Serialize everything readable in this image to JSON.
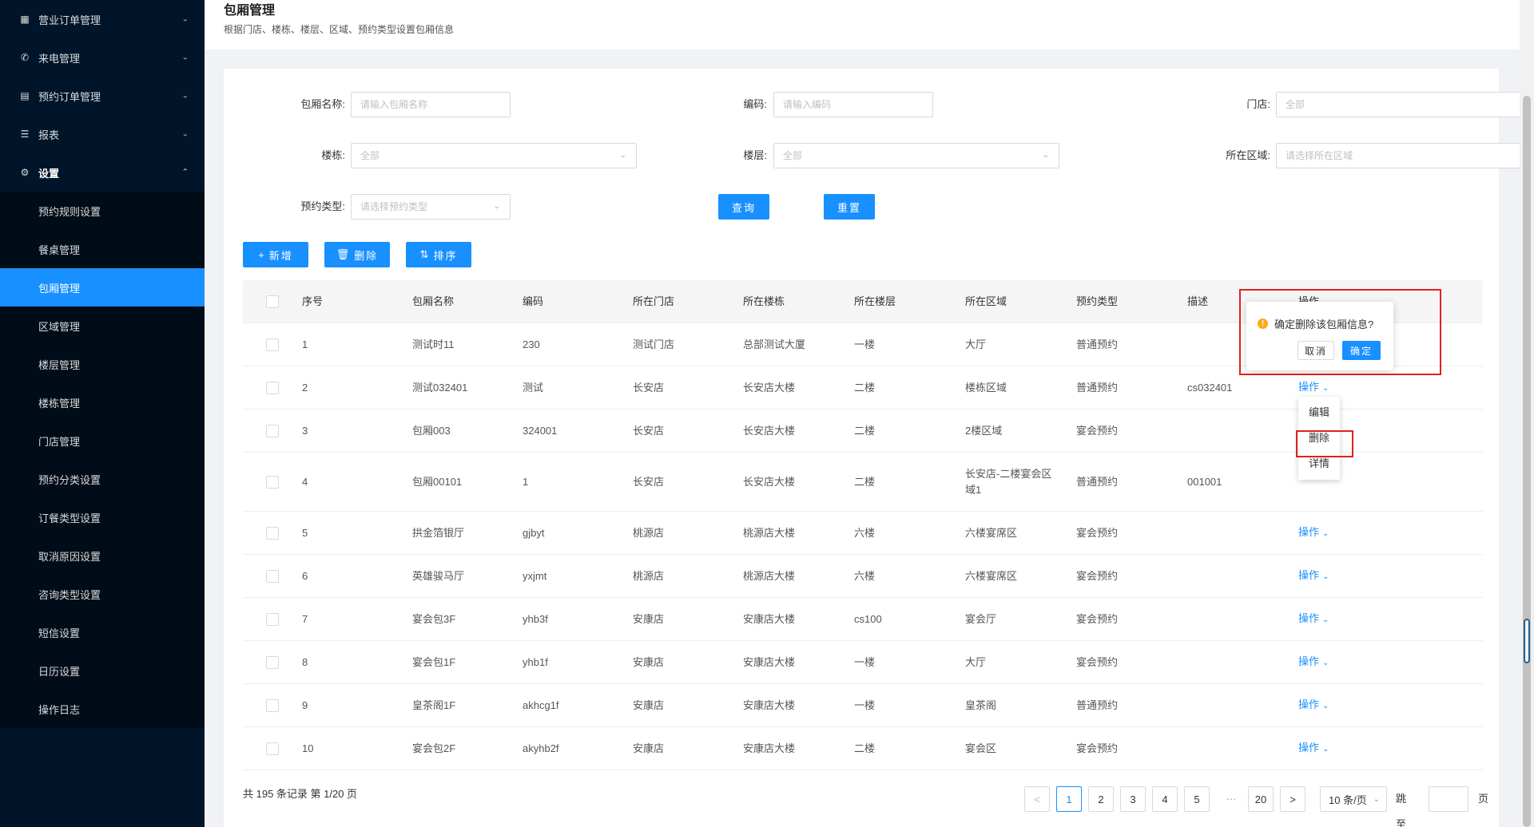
{
  "sidebar": {
    "items": [
      {
        "label": "营业订单管理",
        "icon": "grid-icon"
      },
      {
        "label": "来电管理",
        "icon": "phone-icon"
      },
      {
        "label": "预约订单管理",
        "icon": "calendar-icon"
      },
      {
        "label": "报表",
        "icon": "list-icon"
      },
      {
        "label": "设置",
        "icon": "gear-icon"
      }
    ],
    "submenu": [
      "预约规则设置",
      "餐桌管理",
      "包厢管理",
      "区域管理",
      "楼层管理",
      "楼栋管理",
      "门店管理",
      "预约分类设置",
      "订餐类型设置",
      "取消原因设置",
      "咨询类型设置",
      "短信设置",
      "日历设置",
      "操作日志"
    ],
    "active_item": "包厢管理",
    "accent_color": "#1890ff"
  },
  "header": {
    "title": "包厢管理",
    "description": "根据门店、楼栋、楼层、区域、预约类型设置包厢信息"
  },
  "filters": {
    "name_label": "包厢名称:",
    "name_placeholder": "请输入包厢名称",
    "code_label": "编码:",
    "code_placeholder": "请输入编码",
    "store_label": "门店:",
    "store_value": "全部",
    "building_label": "楼栋:",
    "building_value": "全部",
    "floor_label": "楼层:",
    "floor_value": "全部",
    "area_label": "所在区域:",
    "area_placeholder": "请选择所在区域",
    "type_label": "预约类型:",
    "type_placeholder": "请选择预约类型",
    "query_button": "查询",
    "reset_button": "重置"
  },
  "toolbar": {
    "add_label": "新增",
    "delete_label": "删除",
    "sort_label": "排序"
  },
  "table": {
    "columns": [
      "序号",
      "包厢名称",
      "编码",
      "所在门店",
      "所在楼栋",
      "所在楼层",
      "所在区域",
      "预约类型",
      "描述",
      "操作"
    ],
    "rows": [
      {
        "no": "1",
        "name": "测试时11",
        "code": "230",
        "store": "测试门店",
        "building": "总部测试大厦",
        "floor": "一楼",
        "area": "大厅",
        "type": "普通预约",
        "desc": "",
        "op": ""
      },
      {
        "no": "2",
        "name": "测试032401",
        "code": "测试",
        "store": "长安店",
        "building": "长安店大楼",
        "floor": "二楼",
        "area": "楼栋区域",
        "type": "普通预约",
        "desc": "cs032401",
        "op": "操作"
      },
      {
        "no": "3",
        "name": "包厢003",
        "code": "324001",
        "store": "长安店",
        "building": "长安店大楼",
        "floor": "二楼",
        "area": "2楼区域",
        "type": "宴会预约",
        "desc": "",
        "op": ""
      },
      {
        "no": "4",
        "name": "包厢00101",
        "code": "1",
        "store": "长安店",
        "building": "长安店大楼",
        "floor": "二楼",
        "area": "长安店-二楼宴会区域1",
        "type": "普通预约",
        "desc": "001001",
        "op": ""
      },
      {
        "no": "5",
        "name": "拱金箔银厅",
        "code": "gjbyt",
        "store": "桃源店",
        "building": "桃源店大楼",
        "floor": "六楼",
        "area": "六楼宴席区",
        "type": "宴会预约",
        "desc": "",
        "op": "操作"
      },
      {
        "no": "6",
        "name": "英雄骏马厅",
        "code": "yxjmt",
        "store": "桃源店",
        "building": "桃源店大楼",
        "floor": "六楼",
        "area": "六楼宴席区",
        "type": "宴会预约",
        "desc": "",
        "op": "操作"
      },
      {
        "no": "7",
        "name": "宴会包3F",
        "code": "yhb3f",
        "store": "安康店",
        "building": "安康店大楼",
        "floor": "cs100",
        "area": "宴会厅",
        "type": "宴会预约",
        "desc": "",
        "op": "操作"
      },
      {
        "no": "8",
        "name": "宴会包1F",
        "code": "yhb1f",
        "store": "安康店",
        "building": "安康店大楼",
        "floor": "一楼",
        "area": "大厅",
        "type": "宴会预约",
        "desc": "",
        "op": "操作"
      },
      {
        "no": "9",
        "name": "皇茶阁1F",
        "code": "akhcg1f",
        "store": "安康店",
        "building": "安康店大楼",
        "floor": "一楼",
        "area": "皇茶阁",
        "type": "普通预约",
        "desc": "",
        "op": "操作"
      },
      {
        "no": "10",
        "name": "宴会包2F",
        "code": "akyhb2f",
        "store": "安康店",
        "building": "安康店大楼",
        "floor": "二楼",
        "area": "宴会区",
        "type": "宴会预约",
        "desc": "",
        "op": "操作"
      }
    ]
  },
  "pagination": {
    "summary": "共 195 条记录 第 1/20 页",
    "prev": "<",
    "pages": [
      "1",
      "2",
      "3",
      "4",
      "5"
    ],
    "ellipsis": "···",
    "last_page": "20",
    "next": ">",
    "page_size": "10 条/页",
    "jump_label": "跳至",
    "page_suffix": "页",
    "current_page": 1
  },
  "dropdown": {
    "items": [
      "编辑",
      "删除",
      "详情"
    ]
  },
  "popconfirm": {
    "message": "确定删除该包厢信息?",
    "cancel": "取消",
    "ok": "确定"
  }
}
